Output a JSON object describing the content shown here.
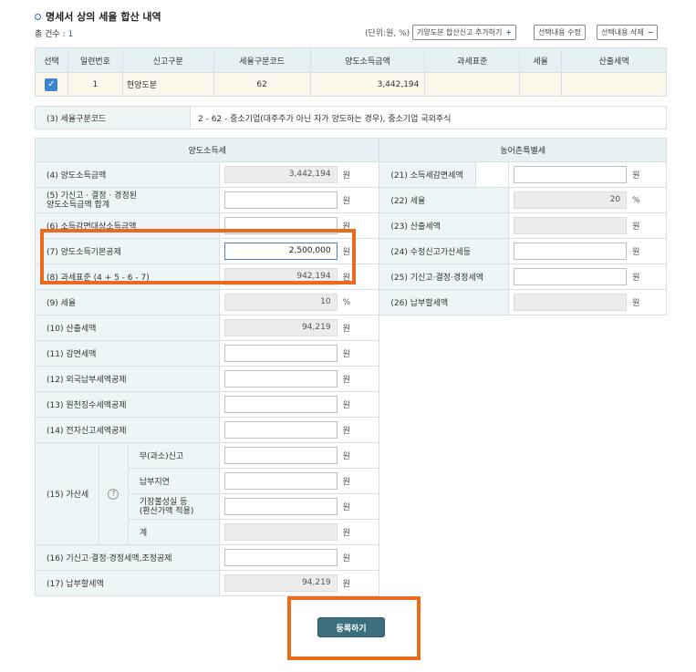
{
  "title": "명세서 상의 세율 합산 내역",
  "count_label": "총 건수 :",
  "count_value": "1",
  "unit_note": "(단위:원, %)",
  "toolbar": {
    "add_label": "기양도분 합산신고 추가하기",
    "add_symbol": "+",
    "edit_label": "선택내용 수정",
    "delete_label": "선택내용 삭제",
    "delete_symbol": "−"
  },
  "summary": {
    "headers": [
      "선택",
      "일련번호",
      "신고구분",
      "세율구분코드",
      "양도소득금액",
      "과세표준",
      "세율",
      "산출세액"
    ],
    "row": {
      "serial": "1",
      "type": "현양도분",
      "code": "62",
      "amount": "3,442,194",
      "base": "",
      "rate": "",
      "tax": ""
    }
  },
  "code_row": {
    "label": "(3) 세율구분코드",
    "value": "2  -  62  -  중소기업(대주주가 아닌 자가 양도하는 경우), 중소기업 국외주식"
  },
  "sections": {
    "left": "양도소득세",
    "right": "농어촌특별세"
  },
  "units": {
    "won": "원",
    "pct": "%"
  },
  "rows": {
    "r4": {
      "label": "(4) 양도소득금액",
      "value": "3,442,194"
    },
    "r5": {
      "label": "(5) 기신고 · 결정 · 경정된\n양도소득금액 합계",
      "value": ""
    },
    "r6": {
      "label": "(6) 소득감면대상소득금액",
      "value": ""
    },
    "r7": {
      "label": "(7) 양도소득기본공제",
      "value": "2,500,000"
    },
    "r8": {
      "label": "(8) 과세표준 (4 + 5 - 6 - 7)",
      "value": "942,194"
    },
    "r9": {
      "label": "(9) 세율",
      "value": "10"
    },
    "r10": {
      "label": "(10) 산출세액",
      "value": "94,219"
    },
    "r11": {
      "label": "(11) 감면세액",
      "value": ""
    },
    "r12": {
      "label": "(12) 외국납부세액공제",
      "value": ""
    },
    "r13": {
      "label": "(13) 원천징수세액공제",
      "value": ""
    },
    "r14": {
      "label": "(14) 전자신고세액공제",
      "value": ""
    },
    "r15": {
      "label": "(15) 가산세",
      "help": "?",
      "sub1": "무(과소)신고",
      "sub2": "납부지연",
      "sub3": "기장불성실 등\n(환산가액 적용)",
      "sub4": "계"
    },
    "r16": {
      "label": "(16) 기신고·결정·경정세액,조정공제",
      "value": ""
    },
    "r17": {
      "label": "(17) 납부할세액",
      "value": "94,219"
    },
    "r21": {
      "label": "(21) 소득세감면세액",
      "value": ""
    },
    "r22": {
      "label": "(22) 세율",
      "value": "20"
    },
    "r23": {
      "label": "(23) 산출세액",
      "value": ""
    },
    "r24": {
      "label": "(24) 수정신고가산세등",
      "value": ""
    },
    "r25": {
      "label": "(25) 기신고·결정·경정세액",
      "value": ""
    },
    "r26": {
      "label": "(26) 납부할세액",
      "value": ""
    }
  },
  "submit_label": "등록하기",
  "colors": {
    "accent": "#2a66b8",
    "highlight": "#ec6a1c",
    "button": "#3a6f7e"
  }
}
